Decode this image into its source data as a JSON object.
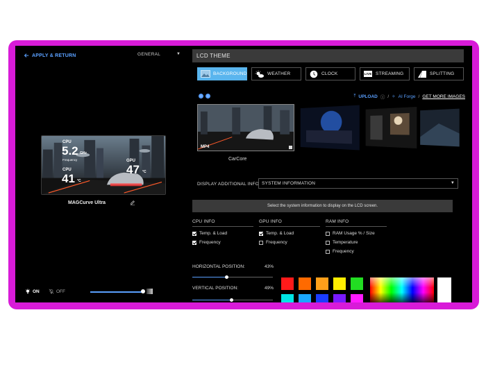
{
  "header": {
    "back_label": "APPLY & RETURN",
    "general_label": "GENERAL"
  },
  "preview": {
    "cpu_label": "CPU",
    "cpu_freq": "5.2",
    "cpu_freq_unit": "GHz",
    "cpu_freq_label": "Frequency",
    "cpu_temp": "41",
    "cpu_temp_unit": "°C",
    "gpu_label": "GPU",
    "gpu_temp": "47",
    "gpu_temp_unit": "°C",
    "device_name": "MAGCurve Ultra"
  },
  "power": {
    "on_label": "ON",
    "off_label": "OFF",
    "brightness": 0.95
  },
  "lcd": {
    "title": "LCD THEME",
    "tabs": [
      {
        "label": "BACKGROUND",
        "active": true
      },
      {
        "label": "WEATHER",
        "active": false
      },
      {
        "label": "CLOCK",
        "active": false
      },
      {
        "label": "STREAMING",
        "active": false
      },
      {
        "label": "SPLITTING",
        "active": false
      }
    ],
    "live_badge": "LIVE",
    "links": {
      "upload": "UPLOAD",
      "ai_forge": "AI Forge",
      "more": "GET MORE IMAGES",
      "separator": "/"
    },
    "selected_media_type": "MP4",
    "selected_caption": "CarCore",
    "display_info_label": "DISPLAY ADDITIONAL INFO",
    "display_info_value": "SYSTEM INFORMATION",
    "info_hint": "Select the system information to display on the LCD screen.",
    "columns": [
      {
        "title": "CPU INFO",
        "options": [
          {
            "label": "Temp. & Load",
            "checked": true
          },
          {
            "label": "Frequency",
            "checked": true
          }
        ]
      },
      {
        "title": "GPU INFO",
        "options": [
          {
            "label": "Temp. & Load",
            "checked": true
          },
          {
            "label": "Frequency",
            "checked": false
          }
        ]
      },
      {
        "title": "RAM INFO",
        "options": [
          {
            "label": "RAM Usage % / Size",
            "checked": false
          },
          {
            "label": "Temperature",
            "checked": false
          },
          {
            "label": "Frequency",
            "checked": false
          }
        ]
      }
    ],
    "horizontal_label": "HORIZONTAL POSITION:",
    "horizontal_value": "43%",
    "horizontal_fraction": 0.43,
    "vertical_label": "VERTICAL POSITION:",
    "vertical_value": "49%",
    "vertical_fraction": 0.49,
    "swatches_row1": [
      "#ff1a1a",
      "#ff6a00",
      "#ff9f1a",
      "#ffee00",
      "#22dd22"
    ],
    "swatches_row2": [
      "#00e5e5",
      "#1aa8ff",
      "#1a3cff",
      "#7a1aff",
      "#ff1aff"
    ]
  }
}
